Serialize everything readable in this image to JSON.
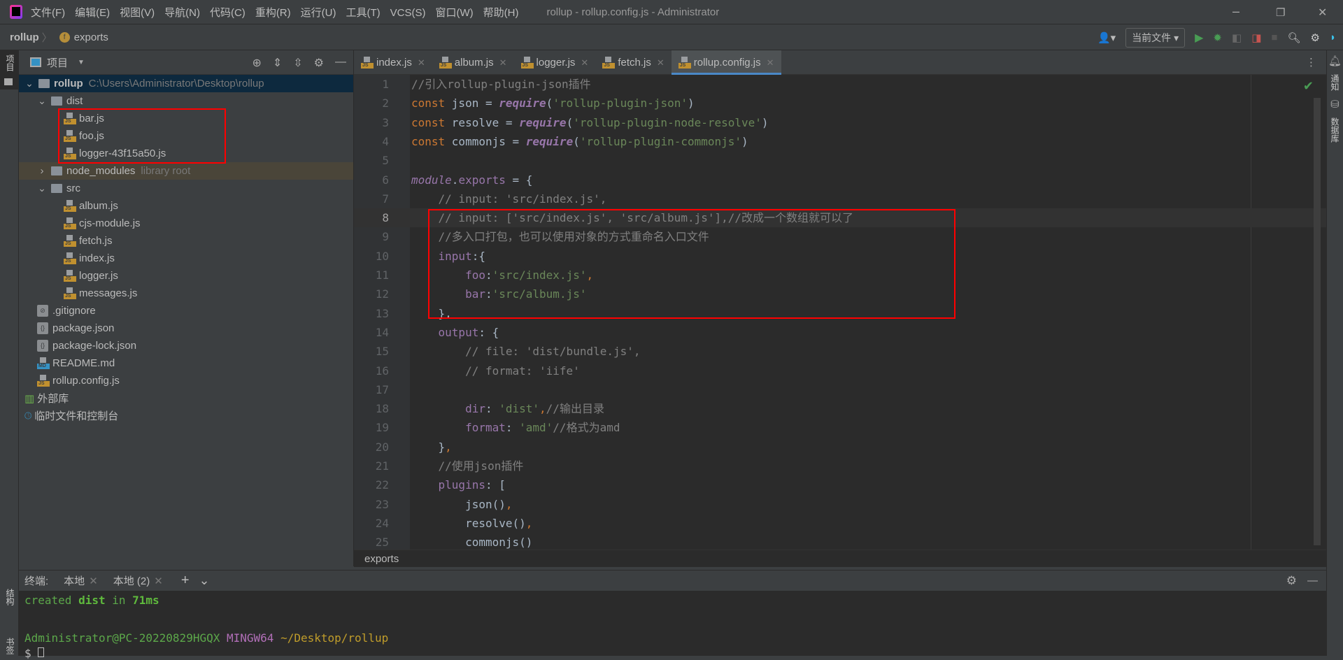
{
  "titlebar": {
    "menus": [
      "文件(F)",
      "编辑(E)",
      "视图(V)",
      "导航(N)",
      "代码(C)",
      "重构(R)",
      "运行(U)",
      "工具(T)",
      "VCS(S)",
      "窗口(W)",
      "帮助(H)"
    ],
    "title": "rollup - rollup.config.js - Administrator",
    "min": "–",
    "max": "❐",
    "close": "✕"
  },
  "navbar": {
    "project": "rollup",
    "sep": "〉",
    "badge": "f",
    "symbol": "exports",
    "run_config": "当前文件 ▾"
  },
  "left_strip": {
    "project_label": "项目",
    "structure_label": "结构",
    "bookmarks_label": "书签"
  },
  "right_strip": {
    "notifications_label": "通知",
    "database_label": "数据库"
  },
  "project_panel": {
    "title": "项目",
    "tree": [
      {
        "label": "rollup",
        "extra": "C:\\Users\\Administrator\\Desktop\\rollup",
        "type": "folder",
        "depth": 0,
        "open": true,
        "state": "sel"
      },
      {
        "label": "dist",
        "type": "folder",
        "depth": 1,
        "open": true
      },
      {
        "label": "bar.js",
        "type": "js",
        "depth": 2
      },
      {
        "label": "foo.js",
        "type": "js",
        "depth": 2
      },
      {
        "label": "logger-43f15a50.js",
        "type": "js",
        "depth": 2
      },
      {
        "label": "node_modules",
        "extra": "library root",
        "type": "folder",
        "depth": 1,
        "open": false,
        "state": "lib"
      },
      {
        "label": "src",
        "type": "folder",
        "depth": 1,
        "open": true
      },
      {
        "label": "album.js",
        "type": "js",
        "depth": 2
      },
      {
        "label": "cjs-module.js",
        "type": "js",
        "depth": 2
      },
      {
        "label": "fetch.js",
        "type": "js",
        "depth": 2
      },
      {
        "label": "index.js",
        "type": "js",
        "depth": 2
      },
      {
        "label": "logger.js",
        "type": "js",
        "depth": 2
      },
      {
        "label": "messages.js",
        "type": "js",
        "depth": 2
      },
      {
        "label": ".gitignore",
        "type": "git",
        "depth": 1
      },
      {
        "label": "package.json",
        "type": "json",
        "depth": 1
      },
      {
        "label": "package-lock.json",
        "type": "json",
        "depth": 1
      },
      {
        "label": "README.md",
        "type": "md",
        "depth": 1
      },
      {
        "label": "rollup.config.js",
        "type": "js",
        "depth": 1
      },
      {
        "label": "外部库",
        "type": "lib",
        "depth": 0
      },
      {
        "label": "临时文件和控制台",
        "type": "scratch",
        "depth": 0
      }
    ]
  },
  "tabs": [
    {
      "label": "index.js"
    },
    {
      "label": "album.js"
    },
    {
      "label": "logger.js"
    },
    {
      "label": "fetch.js"
    },
    {
      "label": "rollup.config.js",
      "active": true
    }
  ],
  "editor": {
    "current_line": 8,
    "lines": [
      [
        [
          "//引入rollup-plugin-json插件",
          "c"
        ]
      ],
      [
        [
          "const ",
          "k"
        ],
        [
          "json = ",
          ""
        ],
        [
          "require",
          "f"
        ],
        [
          "(",
          ""
        ],
        [
          "'rollup-plugin-json'",
          "s"
        ],
        [
          ")",
          ""
        ]
      ],
      [
        [
          "const ",
          "k"
        ],
        [
          "resolve = ",
          ""
        ],
        [
          "require",
          "f"
        ],
        [
          "(",
          ""
        ],
        [
          "'rollup-plugin-node-resolve'",
          "s"
        ],
        [
          ")",
          ""
        ]
      ],
      [
        [
          "const ",
          "k"
        ],
        [
          "commonjs = ",
          ""
        ],
        [
          "require",
          "f"
        ],
        [
          "(",
          ""
        ],
        [
          "'rollup-plugin-commonjs'",
          "s"
        ],
        [
          ")",
          ""
        ]
      ],
      [],
      [
        [
          "module",
          "m"
        ],
        [
          ".",
          ""
        ],
        [
          "exports",
          "p"
        ],
        [
          " = {",
          ""
        ]
      ],
      [
        [
          "    // input: 'src/index.js',",
          "c"
        ]
      ],
      [
        [
          "    // input: ['src/index.js', 'src/album.js'],//改成一个数组就可以了",
          "c"
        ]
      ],
      [
        [
          "    //多入口打包，也可以使用对象的方式重命名入口文件",
          "c"
        ]
      ],
      [
        [
          "    ",
          ""
        ],
        [
          "input",
          "p"
        ],
        [
          ":{",
          ""
        ]
      ],
      [
        [
          "        ",
          ""
        ],
        [
          "foo",
          "p"
        ],
        [
          ":",
          ""
        ],
        [
          "'src/index.js'",
          "s"
        ],
        [
          ",",
          "k"
        ]
      ],
      [
        [
          "        ",
          ""
        ],
        [
          "bar",
          "p"
        ],
        [
          ":",
          ""
        ],
        [
          "'src/album.js'",
          "s"
        ]
      ],
      [
        [
          "    },",
          ""
        ]
      ],
      [
        [
          "    ",
          ""
        ],
        [
          "output",
          "p"
        ],
        [
          ": {",
          ""
        ]
      ],
      [
        [
          "        // file: 'dist/bundle.js',",
          "c"
        ]
      ],
      [
        [
          "        // format: 'iife'",
          "c"
        ]
      ],
      [],
      [
        [
          "        ",
          ""
        ],
        [
          "dir",
          "p"
        ],
        [
          ": ",
          ""
        ],
        [
          "'dist'",
          "s"
        ],
        [
          ",",
          "k"
        ],
        [
          "//输出目录",
          "c"
        ]
      ],
      [
        [
          "        ",
          ""
        ],
        [
          "format",
          "p"
        ],
        [
          ": ",
          ""
        ],
        [
          "'amd'",
          "s"
        ],
        [
          "//格式为amd",
          "c"
        ]
      ],
      [
        [
          "    }",
          ""
        ],
        [
          ",",
          "k"
        ]
      ],
      [
        [
          "    //使用json插件",
          "c"
        ]
      ],
      [
        [
          "    ",
          ""
        ],
        [
          "plugins",
          "p"
        ],
        [
          ": [",
          ""
        ]
      ],
      [
        [
          "        json()",
          ""
        ],
        [
          ",",
          "k"
        ]
      ],
      [
        [
          "        resolve()",
          ""
        ],
        [
          ",",
          "k"
        ]
      ],
      [
        [
          "        commonjs()",
          ""
        ]
      ]
    ]
  },
  "breadcrumb": "exports",
  "terminal": {
    "label": "终端:",
    "tabs": [
      "本地",
      "本地 (2)"
    ],
    "add": "+",
    "more": "⌄",
    "line1": {
      "a": "created ",
      "b": "dist",
      "c": " in ",
      "d": "71ms"
    },
    "prompt": {
      "user": "Administrator@PC-20220829HGQX",
      "env": "MINGW64",
      "path": "~/Desktop/rollup"
    },
    "prompt_char": "$"
  },
  "colors": {
    "accent": "#4a88c7",
    "highlight_box": "#ff0000",
    "editor_bg": "#2b2b2b",
    "panel_bg": "#3c3f41"
  }
}
